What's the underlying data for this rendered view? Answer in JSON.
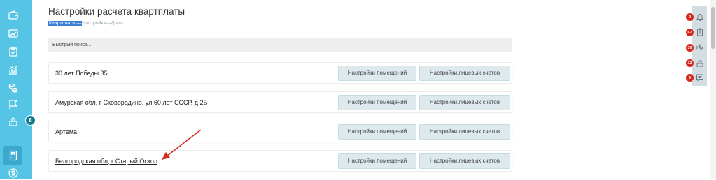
{
  "page": {
    "title": "Настройки расчета квартплаты",
    "breadcrumbs": {
      "first": "Квартплата",
      "sep1": " — ",
      "second": "Настройки",
      "sep2": " — ",
      "third": "Дома"
    },
    "search_placeholder": "Быстрый поиск..."
  },
  "rows": [
    {
      "address": "30 лет Победы 35",
      "btn_rooms": "Настройки помещений",
      "btn_accounts": "Настройки лицевых счетов"
    },
    {
      "address": "Амурская обл, г Сковородино, ул 60 лет СССР, д 2Б",
      "btn_rooms": "Настройки помещений",
      "btn_accounts": "Настройки лицевых счетов"
    },
    {
      "address": "Артема",
      "btn_rooms": "Настройки помещений",
      "btn_accounts": "Настройки лицевых счетов"
    },
    {
      "address": "Белгородская обл, г Старый Оскол",
      "btn_rooms": "Настройки помещений",
      "btn_accounts": "Настройки лицевых счетов"
    }
  ],
  "sidebar": {
    "icons": [
      "wallet-icon",
      "bank-icon",
      "clipboard-check-icon",
      "chart-icon",
      "coins-icon",
      "flag-icon",
      "building-icon",
      "calculator-icon",
      "dollar-icon"
    ],
    "badge": "8"
  },
  "right_panel": {
    "items": [
      {
        "icon": "bell-icon",
        "badge": "2"
      },
      {
        "icon": "clipboard-icon",
        "badge": "67"
      },
      {
        "icon": "phone-icon",
        "badge": "39"
      },
      {
        "icon": "worker-icon",
        "badge": "13"
      },
      {
        "icon": "chat-icon",
        "badge": "9"
      }
    ]
  },
  "colors": {
    "sidebar": "#56c4e4",
    "button_bg": "#dde9ec",
    "badge_red": "#d9261c",
    "arrow": "#d62a1e"
  }
}
